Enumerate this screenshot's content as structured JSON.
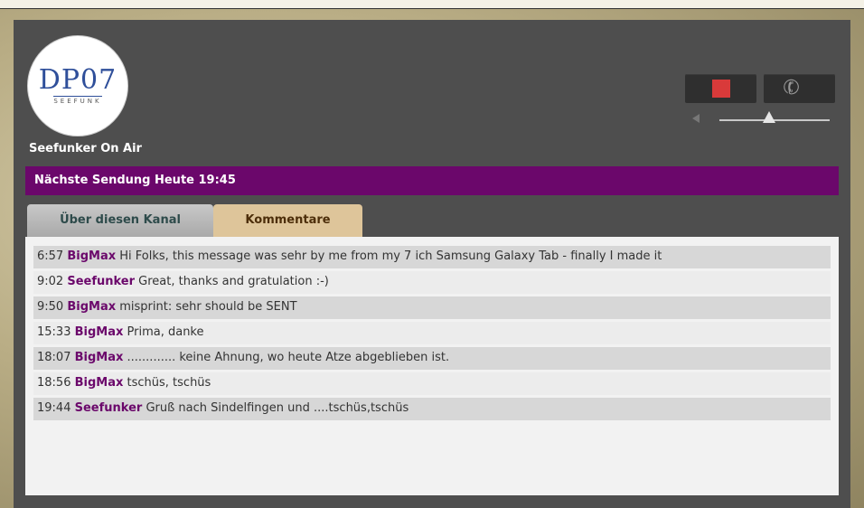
{
  "logo": {
    "main_text": "DP07",
    "sub_text": "SEEFUNK"
  },
  "station": {
    "name": "Seefunker On Air"
  },
  "player": {
    "stop_label": "",
    "call_label": "",
    "volume_level": 0.45
  },
  "schedule": {
    "next_show": "Nächste Sendung Heute 19:45"
  },
  "tabs": [
    {
      "label": "Über diesen Kanal",
      "active": false
    },
    {
      "label": "Kommentare",
      "active": true
    }
  ],
  "comments": [
    {
      "time": "6:57",
      "user": "BigMax",
      "text": "Hi Folks, this message was sehr by me from my 7 ich Samsung Galaxy Tab - finally I made it"
    },
    {
      "time": "9:02",
      "user": "Seefunker",
      "text": "Great, thanks and gratulation :-)"
    },
    {
      "time": "9:50",
      "user": "BigMax",
      "text": "misprint: sehr should be SENT"
    },
    {
      "time": "15:33",
      "user": "BigMax",
      "text": "Prima, danke"
    },
    {
      "time": "18:07",
      "user": "BigMax",
      "text": "............. keine Ahnung, wo heute Atze abgeblieben ist."
    },
    {
      "time": "18:56",
      "user": "BigMax",
      "text": "tschüs, tschüs"
    },
    {
      "time": "19:44",
      "user": "Seefunker",
      "text": "Gruß nach Sindelfingen und ....tschüs,tschüs"
    }
  ],
  "colors": {
    "accent_purple": "#6b076b",
    "stop_red": "#d93a3a",
    "tab_active": "#dec59a"
  }
}
